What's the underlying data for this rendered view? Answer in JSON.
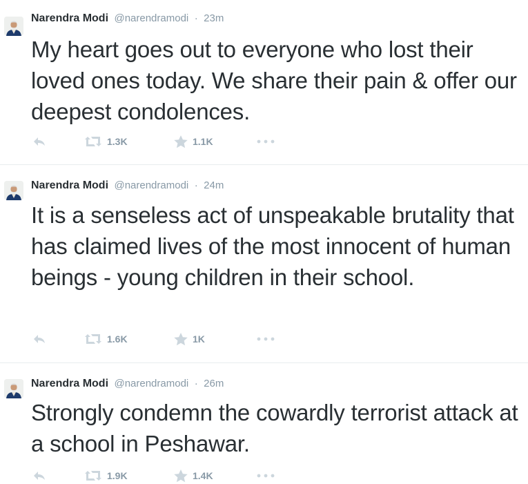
{
  "tweets": [
    {
      "author_name": "Narendra Modi",
      "handle": "@narendramodi",
      "separator": "·",
      "time": "23m",
      "text": "My heart goes out to everyone who lost their loved ones today. We share their pain & offer our deepest condolences.",
      "retweets": "1.3K",
      "favorites": "1.1K"
    },
    {
      "author_name": "Narendra Modi",
      "handle": "@narendramodi",
      "separator": "·",
      "time": "24m",
      "text": "It is a senseless act of unspeakable brutality that has claimed lives of the most innocent of human beings - young children in their school.",
      "retweets": "1.6K",
      "favorites": "1K"
    },
    {
      "author_name": "Narendra Modi",
      "handle": "@narendramodi",
      "separator": "·",
      "time": "26m",
      "text": "Strongly condemn the cowardly terrorist attack at a school in Peshawar.",
      "retweets": "1.9K",
      "favorites": "1.4K"
    }
  ],
  "icons": {
    "reply": "reply-icon",
    "retweet": "retweet-icon",
    "favorite": "star-icon",
    "more": "more-dots-icon",
    "avatar": "profile-photo"
  },
  "colors": {
    "text": "#292f33",
    "muted": "#8899a6",
    "icon": "#ccd6dd",
    "divider": "#e8ecee"
  }
}
